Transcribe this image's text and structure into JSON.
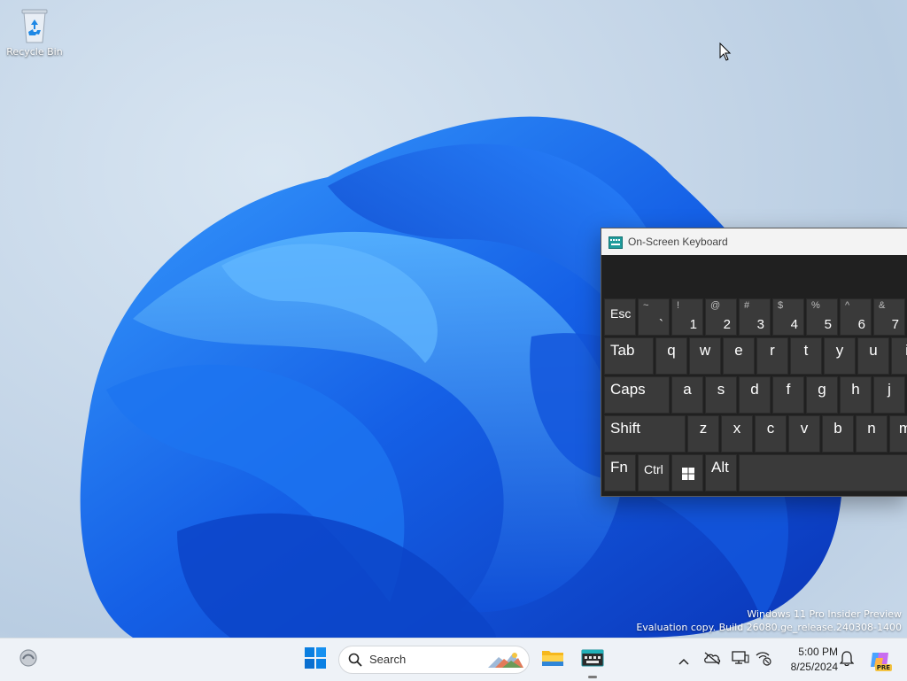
{
  "desktop": {
    "icons": [
      {
        "label": "Recycle Bin",
        "icon": "recycle-bin-icon"
      }
    ],
    "watermark": {
      "line1": "Windows 11 Pro Insider Preview",
      "line2": "Evaluation copy. Build 26080.ge_release.240308-1400"
    }
  },
  "osk": {
    "title": "On-Screen Keyboard",
    "icon": "keyboard-icon",
    "rows": [
      [
        {
          "id": "esc",
          "label": "Esc"
        },
        {
          "id": "backtick",
          "shift": "~",
          "label": "`"
        },
        {
          "id": "1",
          "shift": "!",
          "label": "1"
        },
        {
          "id": "2",
          "shift": "@",
          "label": "2"
        },
        {
          "id": "3",
          "shift": "#",
          "label": "3"
        },
        {
          "id": "4",
          "shift": "$",
          "label": "4"
        },
        {
          "id": "5",
          "shift": "%",
          "label": "5"
        },
        {
          "id": "6",
          "shift": "^",
          "label": "6"
        },
        {
          "id": "7",
          "shift": "&",
          "label": "7"
        }
      ],
      [
        {
          "id": "tab",
          "label": "Tab"
        },
        {
          "id": "q",
          "label": "q"
        },
        {
          "id": "w",
          "label": "w"
        },
        {
          "id": "e",
          "label": "e"
        },
        {
          "id": "r",
          "label": "r"
        },
        {
          "id": "t",
          "label": "t"
        },
        {
          "id": "y",
          "label": "y"
        },
        {
          "id": "u",
          "label": "u"
        },
        {
          "id": "i",
          "label": "i"
        }
      ],
      [
        {
          "id": "caps",
          "label": "Caps"
        },
        {
          "id": "a",
          "label": "a"
        },
        {
          "id": "s",
          "label": "s"
        },
        {
          "id": "d",
          "label": "d"
        },
        {
          "id": "f",
          "label": "f"
        },
        {
          "id": "g",
          "label": "g"
        },
        {
          "id": "h",
          "label": "h"
        },
        {
          "id": "j",
          "label": "j"
        }
      ],
      [
        {
          "id": "shift",
          "label": "Shift"
        },
        {
          "id": "z",
          "label": "z"
        },
        {
          "id": "x",
          "label": "x"
        },
        {
          "id": "c",
          "label": "c"
        },
        {
          "id": "v",
          "label": "v"
        },
        {
          "id": "b",
          "label": "b"
        },
        {
          "id": "n",
          "label": "n"
        },
        {
          "id": "m",
          "label": "m"
        }
      ],
      [
        {
          "id": "fn",
          "label": "Fn"
        },
        {
          "id": "ctrl",
          "label": "Ctrl"
        },
        {
          "id": "win",
          "label": "",
          "icon": "windows-logo-icon"
        },
        {
          "id": "alt",
          "label": "Alt"
        },
        {
          "id": "space",
          "label": ""
        }
      ]
    ]
  },
  "taskbar": {
    "start_icon": "windows-start-icon",
    "search_placeholder": "Search",
    "apps": [
      {
        "name": "File Explorer",
        "icon": "folder-icon"
      },
      {
        "name": "On-Screen Keyboard",
        "icon": "keyboard-icon",
        "active": true
      }
    ],
    "tray": {
      "icons": [
        "chevron-up-icon",
        "onedrive-icon",
        "display-icon",
        "network-icon"
      ],
      "time": "5:00 PM",
      "date": "8/25/2024",
      "notification_icon": "bell-icon",
      "copilot_badge": "PRE"
    }
  },
  "colors": {
    "accent": "#0067c0",
    "key_bg": "#3a3a3a",
    "osk_bg": "#202020"
  }
}
